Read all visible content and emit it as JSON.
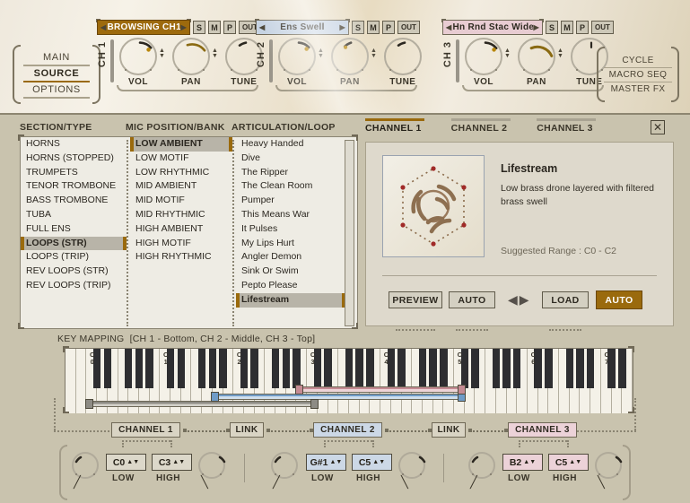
{
  "header": {
    "nav": {
      "items": [
        {
          "label": "MAIN",
          "active": false
        },
        {
          "label": "SOURCE",
          "active": true
        },
        {
          "label": "OPTIONS",
          "active": false
        }
      ]
    },
    "right_menu": {
      "items": [
        {
          "label": "CYCLE"
        },
        {
          "label": "MACRO SEQ"
        },
        {
          "label": "MASTER FX"
        }
      ]
    },
    "channels": [
      {
        "id": "CH 1",
        "preset_name": "BROWSING CH1",
        "name_style": "gold",
        "buttons": [
          "S",
          "M",
          "P",
          "OUT"
        ],
        "knobs": [
          {
            "label": "VOL",
            "value": 62
          },
          {
            "label": "PAN",
            "value": 50
          },
          {
            "label": "TUNE",
            "value": 12
          }
        ]
      },
      {
        "id": "CH 2",
        "preset_name": "Ens Swell",
        "name_style": "blue",
        "buttons": [
          "S",
          "M",
          "P",
          "OUT"
        ],
        "knobs": [
          {
            "label": "VOL",
            "value": 58
          },
          {
            "label": "PAN",
            "value": 16
          },
          {
            "label": "TUNE",
            "value": 10
          }
        ]
      },
      {
        "id": "CH 3",
        "preset_name": "Hn Rnd Stac Wide",
        "name_style": "pink",
        "buttons": [
          "S",
          "M",
          "P",
          "OUT"
        ],
        "knobs": [
          {
            "label": "VOL",
            "value": 60
          },
          {
            "label": "PAN",
            "value": 78
          },
          {
            "label": "TUNE",
            "value": 50
          }
        ]
      }
    ]
  },
  "browser": {
    "columns": [
      {
        "title": "SECTION/TYPE",
        "items": [
          "HORNS",
          "HORNS (STOPPED)",
          "TRUMPETS",
          "TENOR TROMBONE",
          "BASS TROMBONE",
          "TUBA",
          "FULL ENS",
          "LOOPS (STR)",
          "LOOPS (TRIP)",
          "REV LOOPS (STR)",
          "REV LOOPS (TRIP)"
        ],
        "selected": "LOOPS (STR)"
      },
      {
        "title": "MIC POSITION/BANK",
        "items": [
          "LOW AMBIENT",
          "LOW MOTIF",
          "LOW RHYTHMIC",
          "MID AMBIENT",
          "MID MOTIF",
          "MID RHYTHMIC",
          "HIGH AMBIENT",
          "HIGH MOTIF",
          "HIGH RHYTHMIC"
        ],
        "selected": "LOW AMBIENT"
      },
      {
        "title": "ARTICULATION/LOOP",
        "items": [
          "Heavy Handed",
          "Dive",
          "The Ripper",
          "The Clean Room",
          "Pumper",
          "This Means War",
          "It Pulses",
          "My Lips Hurt",
          "Angler Demon",
          "Sink Or Swim",
          "Pepto Please",
          "Lifestream"
        ],
        "selected": "Lifestream"
      }
    ]
  },
  "detail": {
    "tabs": [
      {
        "label": "CHANNEL 1",
        "active": true
      },
      {
        "label": "CHANNEL 2",
        "active": false
      },
      {
        "label": "CHANNEL 3",
        "active": false
      }
    ],
    "close_icon": "✕",
    "title": "Lifestream",
    "description": "Low brass drone layered with filtered brass swell",
    "range_label": "Suggested Range :  C0 - C2",
    "buttons": [
      {
        "label": "PREVIEW",
        "active": false,
        "dots": true
      },
      {
        "label": "AUTO",
        "active": false,
        "dots": true
      },
      {
        "label": "LOAD",
        "active": false,
        "dots": true
      },
      {
        "label": "AUTO",
        "active": true,
        "dots": true
      }
    ],
    "nav_prev_icon": "◀",
    "nav_next_icon": "▶"
  },
  "keymapping": {
    "title": "KEY MAPPING",
    "subtitle": "[CH 1 - Bottom, CH 2 - Middle, CH 3 - Top]",
    "octave_labels": [
      "C0",
      "C1",
      "C2",
      "C3",
      "C4",
      "C5",
      "C6",
      "C7"
    ],
    "ranges": [
      {
        "channel": "CH 1",
        "color": "#8d8b84",
        "track": "#d3d1c9",
        "low": "C0",
        "high": "C3"
      },
      {
        "channel": "CH 2",
        "color": "#6f9bc7",
        "track": "#cfdeed",
        "low": "G#1",
        "high": "C5"
      },
      {
        "channel": "CH 3",
        "color": "#c58b93",
        "track": "#eed4d8",
        "low": "B2",
        "high": "C5"
      }
    ]
  },
  "footer": {
    "link_label": "LINK",
    "channels": [
      {
        "chip": "CHANNEL 1",
        "style": "plain",
        "low": {
          "value": "C0",
          "label": "LOW"
        },
        "high": {
          "value": "C3",
          "label": "HIGH"
        }
      },
      {
        "chip": "CHANNEL 2",
        "style": "blue",
        "low": {
          "value": "G#1",
          "label": "LOW"
        },
        "high": {
          "value": "C5",
          "label": "HIGH"
        }
      },
      {
        "chip": "CHANNEL 3",
        "style": "pink",
        "low": {
          "value": "B2",
          "label": "LOW"
        },
        "high": {
          "value": "C5",
          "label": "HIGH"
        }
      }
    ]
  },
  "colors": {
    "accent_gold": "#9a6a0d",
    "panel_bg": "#c9c3ae",
    "list_bg": "#eeece4",
    "ch2_blue": "#ccd8e6",
    "ch3_pink": "#ecd2d8"
  }
}
